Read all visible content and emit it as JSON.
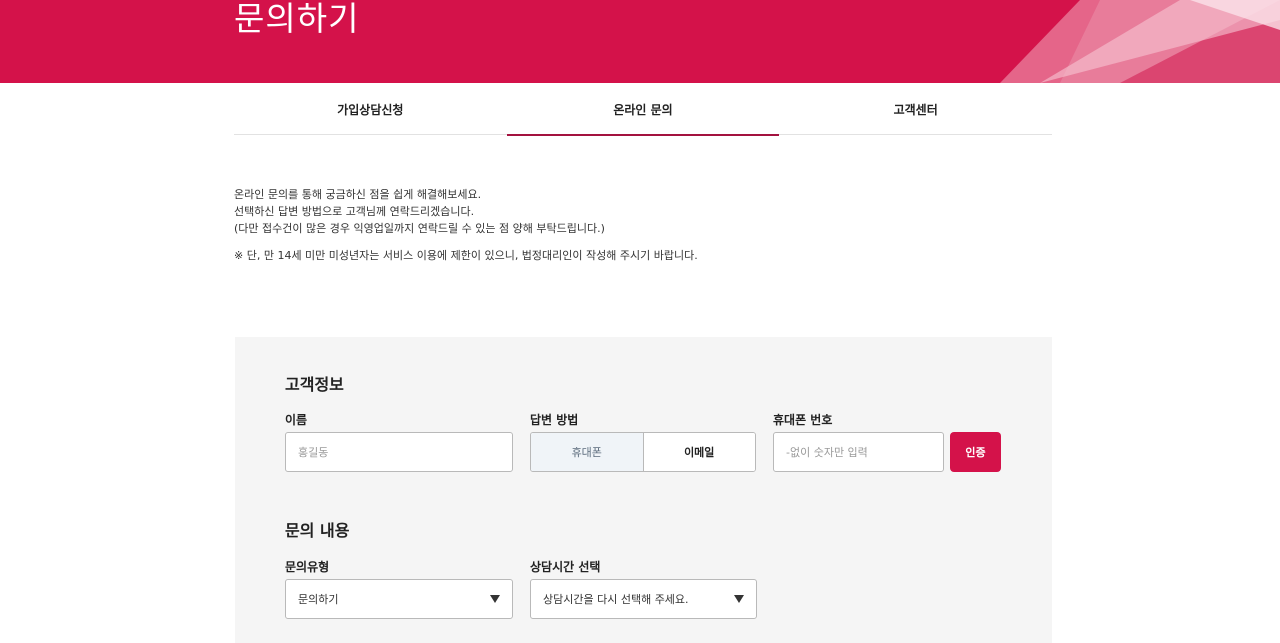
{
  "hero": {
    "title": "문의하기"
  },
  "tabs": [
    {
      "label": "가입상담신청",
      "active": false
    },
    {
      "label": "온라인 문의",
      "active": true
    },
    {
      "label": "고객센터",
      "active": false
    }
  ],
  "intro": {
    "line1": "온라인 문의를 통해 궁금하신 점을 쉽게 해결해보세요.",
    "line2": "선택하신 답변 방법으로 고객님께 연락드리겠습니다.",
    "line3": "(다만 접수건이 많은 경우 익영업일까지 연락드릴 수 있는 점 양해 부탁드립니다.)",
    "note": "※ 단, 만 14세 미만 미성년자는 서비스 이용에 제한이 있으니, 법정대리인이 작성해 주시기 바랍니다."
  },
  "customer_info": {
    "title": "고객정보",
    "name_label": "이름",
    "name_placeholder": "홍길동",
    "answer_method_label": "답변 방법",
    "answer_options": [
      "휴대폰",
      "이메일"
    ],
    "selected_answer": "휴대폰",
    "phone_label": "휴대폰 번호",
    "phone_placeholder": "-없이 숫자만 입력",
    "verify_button": "인증"
  },
  "inquiry": {
    "title": "문의 내용",
    "type_label": "문의유형",
    "type_value": "문의하기",
    "time_label": "상담시간 선택",
    "time_value": "상담시간을 다시 선택해 주세요."
  },
  "colors": {
    "brand": "#d4124a",
    "tab_underline": "#a3123f",
    "panel_bg": "#f5f5f5"
  }
}
